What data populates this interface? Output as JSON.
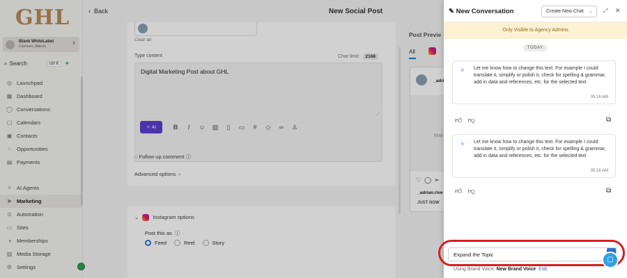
{
  "sidebar": {
    "logo": "GHL",
    "account": {
      "name": "Blank WhiteLabel",
      "location": "Canmore, Alberta"
    },
    "search": {
      "label": "Search",
      "shortcut": "ctrl K"
    },
    "items": [
      {
        "label": "Launchpad",
        "icon": "rocket-icon"
      },
      {
        "label": "Dashboard",
        "icon": "grid-icon"
      },
      {
        "label": "Conversations",
        "icon": "chat-icon"
      },
      {
        "label": "Calendars",
        "icon": "calendar-icon"
      },
      {
        "label": "Contacts",
        "icon": "contacts-icon"
      },
      {
        "label": "Opportunities",
        "icon": "pipeline-icon"
      },
      {
        "label": "Payments",
        "icon": "payments-icon"
      }
    ],
    "items2": [
      {
        "label": "AI Agents",
        "icon": "sparkle-icon"
      },
      {
        "label": "Marketing",
        "icon": "send-icon"
      },
      {
        "label": "Automation",
        "icon": "automation-icon"
      },
      {
        "label": "Sites",
        "icon": "sites-icon"
      },
      {
        "label": "Memberships",
        "icon": "memberships-icon"
      },
      {
        "label": "Media Storage",
        "icon": "media-icon"
      },
      {
        "label": "Settings",
        "icon": "gear-icon"
      }
    ]
  },
  "topbar": {
    "back": "Back",
    "title": "New Social Post"
  },
  "editor": {
    "clear_all": "Clear all",
    "type_label": "Type content",
    "char_limit_label": "Char limit:",
    "char_limit_value": "2168",
    "content": "Digital Marketing Post about GHL",
    "ai_label": "AI",
    "follow_up": "Follow up comment",
    "advanced": "Advanced options",
    "instagram_options": "Instagram options",
    "post_as": "Post this as",
    "post_types": [
      "Feed",
      "Reel",
      "Story"
    ],
    "selected_type": "Feed"
  },
  "preview": {
    "label": "Post Previe",
    "tab_all": "All",
    "name": "_adri",
    "mak": "Mak",
    "user": "_adrian.rive",
    "time": "JUST NOW"
  },
  "chat": {
    "title": "New Conversation",
    "new_chat": "Create New Chat",
    "banner": "Only Visible to Agency Admins",
    "today": "TODAY",
    "messages": [
      {
        "text": "Let me know how to change this text. For example I could translate it, simplify or polish it, check for spelling & grammar, add in data and references, etc. for the selected text",
        "time": "05:16 AM"
      },
      {
        "text": "Let me know how to change this text. For example I could translate it, simplify or polish it, check for spelling & grammar, add in data and references, etc. for the selected text",
        "time": "05:16 AM"
      }
    ],
    "input_value": "Expand the Topic",
    "brand_voice_label": "Using Brand Voice:",
    "brand_voice": "New Brand Voice",
    "edit": "Edit"
  },
  "colors": {
    "accent": "#2f6fd6",
    "ai_button": "#5b3fd1",
    "highlight_ring": "#d81e1e",
    "banner": "#fdf1d4"
  }
}
